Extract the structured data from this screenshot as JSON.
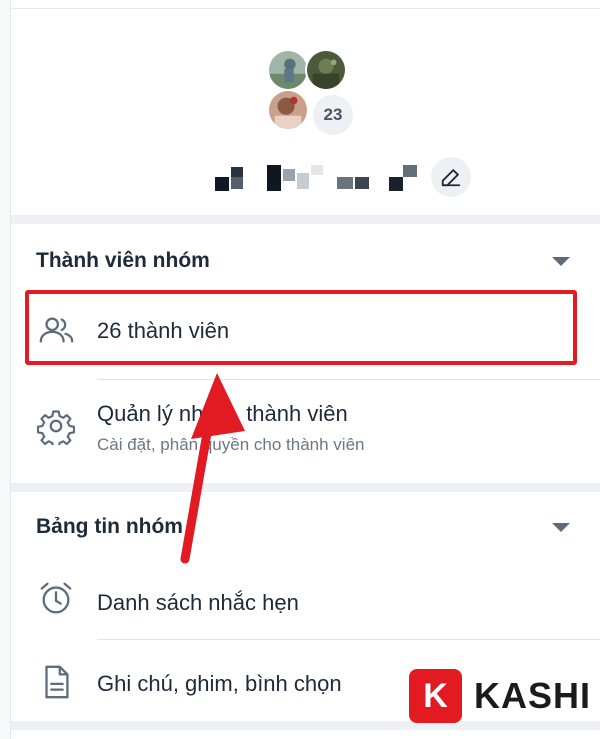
{
  "group": {
    "avatar_overflow_count": "23"
  },
  "members_section": {
    "title": "Thành viên nhóm",
    "members_count_label": "26 thành viên",
    "manage_title": "Quản lý nhóm, thành viên",
    "manage_subtitle": "Cài đặt, phân quyền cho thành viên"
  },
  "feed_section": {
    "title": "Bảng tin nhóm",
    "reminders_label": "Danh sách nhắc hẹn",
    "notes_label": "Ghi chú, ghim, bình chọn"
  },
  "watermark": {
    "badge_letter": "K",
    "brand": "KASHI"
  },
  "colors": {
    "highlight": "#e21b22",
    "text": "#1e2a3a",
    "muted": "#6b7785",
    "icon": "#5d6b7c"
  }
}
